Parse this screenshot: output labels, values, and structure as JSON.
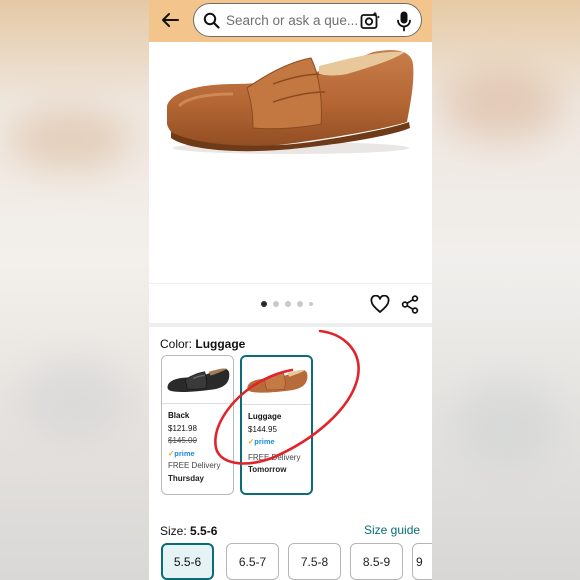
{
  "search": {
    "placeholder": "Search or ask a que..."
  },
  "gallery": {
    "dots": 5,
    "active_dot": 0
  },
  "color": {
    "label": "Color:",
    "selected": "Luggage"
  },
  "swatches": [
    {
      "name": "Black",
      "price": "$121.98",
      "list_price": "$145.00",
      "prime": "prime",
      "delivery": "FREE Delivery",
      "day": "Thursday"
    },
    {
      "name": "Luggage",
      "price": "$144.95",
      "prime": "prime",
      "delivery": "FREE Delivery",
      "day": "Tomorrow"
    }
  ],
  "size": {
    "label": "Size:",
    "selected": "5.5-6",
    "guide": "Size guide",
    "options": [
      "5.5-6",
      "6.5-7",
      "7.5-8",
      "8.5-9",
      "9"
    ]
  },
  "colors": {
    "header": "#f3c58d",
    "accent": "#0b6c78",
    "prime_blue": "#1a8dd6",
    "annotation": "#e0242b"
  }
}
